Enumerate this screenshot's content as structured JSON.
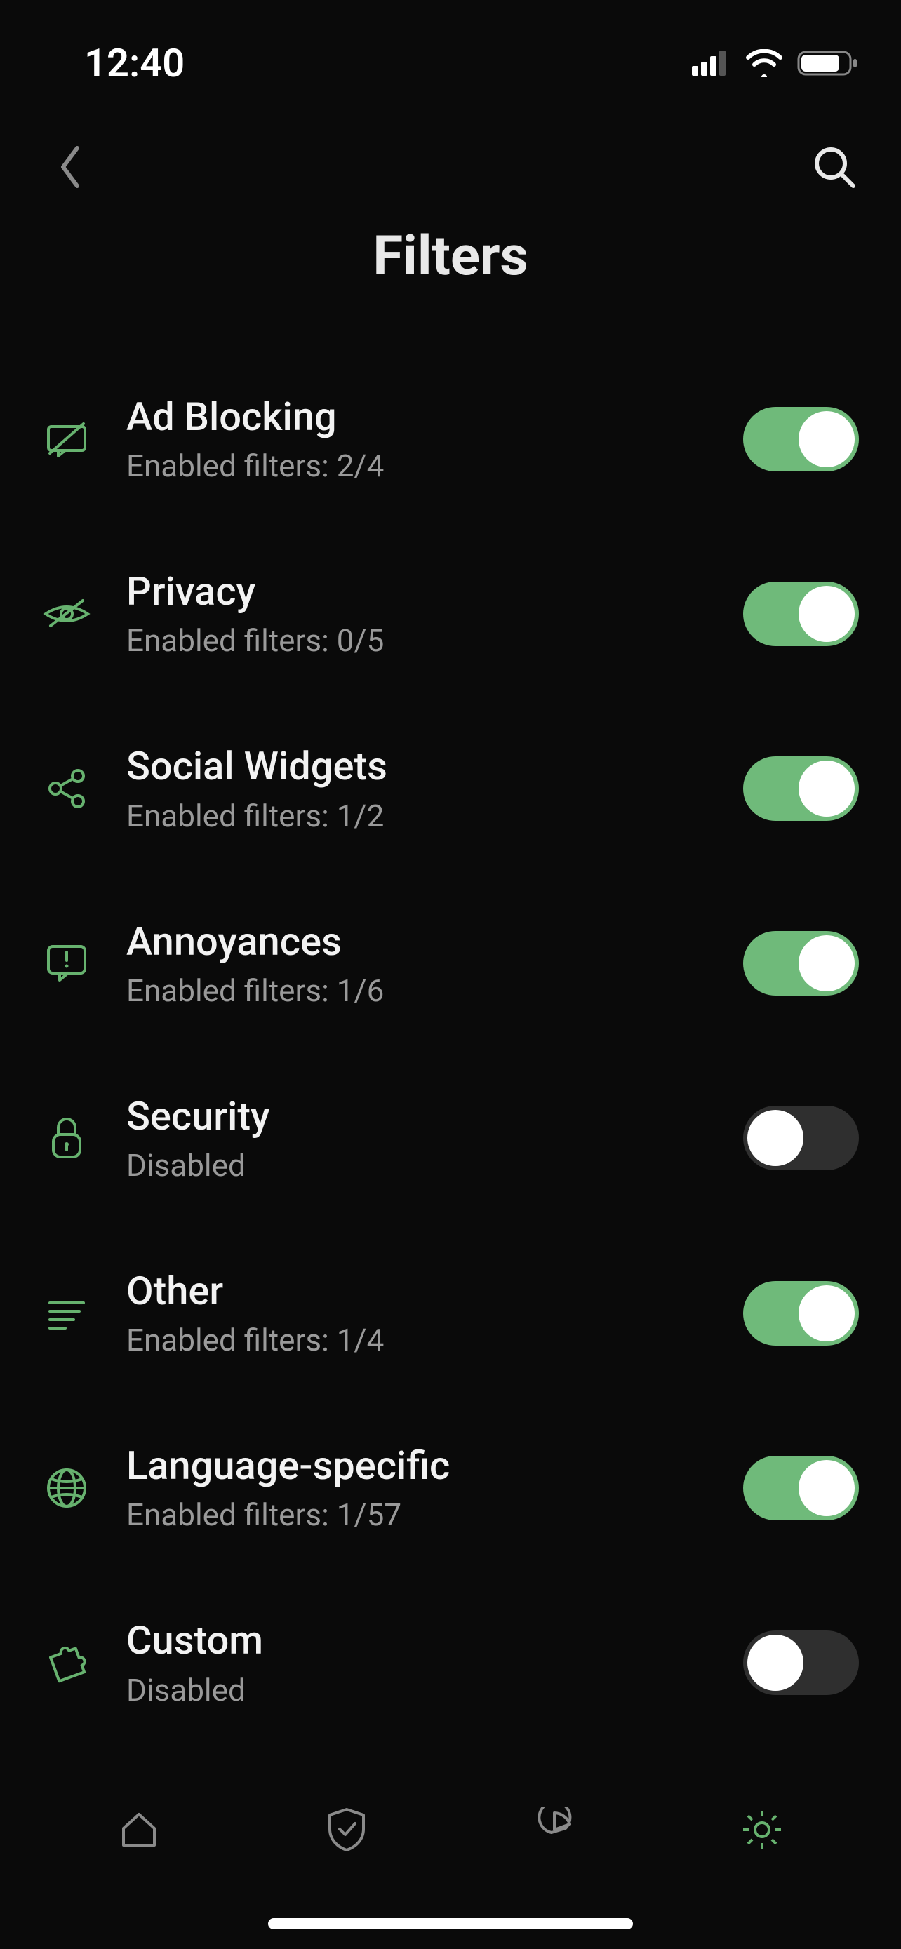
{
  "statusBar": {
    "time": "12:40"
  },
  "page": {
    "title": "Filters"
  },
  "colors": {
    "accent": "#6fba7a",
    "iconStroke": "#67b26f",
    "inactive": "#8a8a8a"
  },
  "filters": [
    {
      "id": "ad-blocking",
      "title": "Ad Blocking",
      "subtitle": "Enabled filters: 2/4",
      "enabled": true,
      "icon": "ad-block"
    },
    {
      "id": "privacy",
      "title": "Privacy",
      "subtitle": "Enabled filters: 0/5",
      "enabled": true,
      "icon": "privacy"
    },
    {
      "id": "social-widgets",
      "title": "Social Widgets",
      "subtitle": "Enabled filters: 1/2",
      "enabled": true,
      "icon": "share"
    },
    {
      "id": "annoyances",
      "title": "Annoyances",
      "subtitle": "Enabled filters: 1/6",
      "enabled": true,
      "icon": "annoyance"
    },
    {
      "id": "security",
      "title": "Security",
      "subtitle": "Disabled",
      "enabled": false,
      "icon": "lock"
    },
    {
      "id": "other",
      "title": "Other",
      "subtitle": "Enabled filters: 1/4",
      "enabled": true,
      "icon": "list"
    },
    {
      "id": "language-specific",
      "title": "Language-specific",
      "subtitle": "Enabled filters: 1/57",
      "enabled": true,
      "icon": "globe"
    },
    {
      "id": "custom",
      "title": "Custom",
      "subtitle": "Disabled",
      "enabled": false,
      "icon": "puzzle"
    }
  ],
  "tabs": [
    {
      "id": "home",
      "icon": "home",
      "active": false
    },
    {
      "id": "protection",
      "icon": "shield",
      "active": false
    },
    {
      "id": "stats",
      "icon": "chart",
      "active": false
    },
    {
      "id": "settings",
      "icon": "gear",
      "active": true
    }
  ]
}
